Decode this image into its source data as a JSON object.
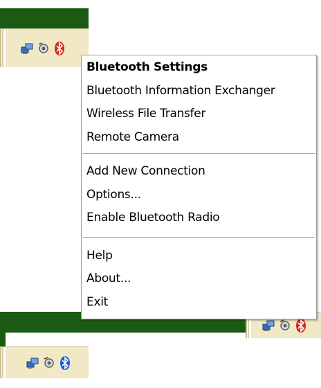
{
  "colors": {
    "taskbar_green": "#1a5a12",
    "tray_background": "#f1e8c6",
    "menu_background": "#ffffff",
    "bluetooth_red": "#d42a1c",
    "bluetooth_blue": "#1c5bd4"
  },
  "tray_top": {
    "icons": [
      "network-computers-icon",
      "speaker-volume-icon",
      "bluetooth-red-icon"
    ]
  },
  "tray_middle": {
    "icons": [
      "network-computers-icon",
      "speaker-volume-icon",
      "bluetooth-red-icon"
    ]
  },
  "tray_bottom": {
    "icons": [
      "network-computers-icon",
      "speaker-volume-icon",
      "bluetooth-blue-icon"
    ]
  },
  "context_menu": {
    "group1": [
      {
        "label": "Bluetooth Settings",
        "bold": true
      },
      {
        "label": "Bluetooth Information Exchanger"
      },
      {
        "label": "Wireless File Transfer"
      },
      {
        "label": "Remote Camera"
      }
    ],
    "group2": [
      {
        "label": "Add New Connection"
      },
      {
        "label": "Options..."
      },
      {
        "label": "Enable Bluetooth Radio"
      }
    ],
    "group3": [
      {
        "label": "Help"
      },
      {
        "label": "About..."
      },
      {
        "label": "Exit"
      }
    ]
  }
}
